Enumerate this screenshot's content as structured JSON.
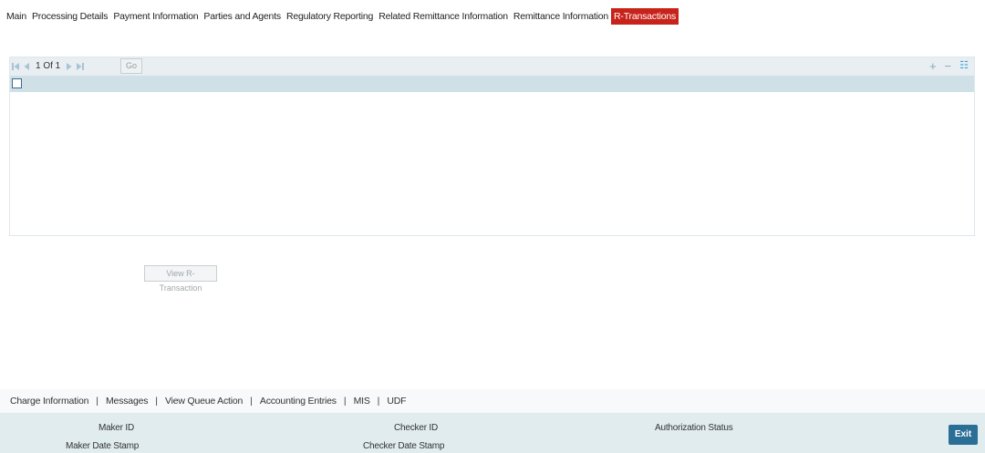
{
  "tabs": [
    {
      "label": "Main"
    },
    {
      "label": "Processing Details"
    },
    {
      "label": "Payment Information"
    },
    {
      "label": "Parties and Agents"
    },
    {
      "label": "Regulatory Reporting"
    },
    {
      "label": "Related Remittance Information"
    },
    {
      "label": "Remittance Information"
    },
    {
      "label": "R-Transactions",
      "active": true
    }
  ],
  "grid": {
    "pager_text": "1 Of 1",
    "go_label": "Go",
    "add_icon": "+",
    "remove_icon": "−",
    "menu_icon": "☷"
  },
  "view_button": "View R-Transaction",
  "footer_links": [
    "Charge Information",
    "Messages",
    "View Queue Action",
    "Accounting Entries",
    "MIS",
    "UDF"
  ],
  "separator": "|",
  "audit": {
    "maker_id": "Maker ID",
    "maker_date_stamp": "Maker Date Stamp",
    "checker_id": "Checker ID",
    "checker_date_stamp": "Checker Date Stamp",
    "authorization_status": "Authorization Status"
  },
  "exit_label": "Exit",
  "colors": {
    "active_tab": "#c7231b",
    "exit_button": "#2b6f97",
    "grid_header": "#cfe0e7"
  }
}
